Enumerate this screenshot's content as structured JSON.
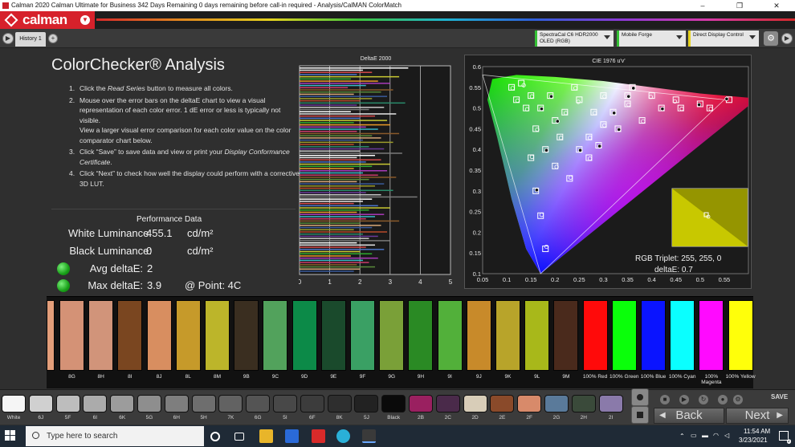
{
  "window": {
    "title": "Calman 2020 Calman Ultimate for Business 342 Days Remaining 0 days remaining before call-in required - Analysis/CalMAN ColorMatch",
    "controls": [
      "–",
      "❐",
      "✕"
    ]
  },
  "brand": {
    "name": "calman"
  },
  "tabs": {
    "history_label": "History 1",
    "add_label": "+",
    "devices": [
      {
        "line1": "SpectraCal C6 HDR2000",
        "line2": "OLED (RGB)",
        "accent": "#34c034"
      },
      {
        "line1": "Mobile Forge",
        "line2": "",
        "accent": "#34c034"
      },
      {
        "line1": "Direct Display Control",
        "line2": "",
        "accent": "#e6d21e"
      }
    ]
  },
  "analysis": {
    "title": "ColorChecker® Analysis",
    "instructions": [
      {
        "num": "1.",
        "parts": [
          {
            "t": "Click the "
          },
          {
            "t": "Read Series",
            "i": true
          },
          {
            "t": " button to measure all colors."
          }
        ]
      },
      {
        "num": "2.",
        "parts": [
          {
            "t": "Mouse over the error bars on the deltaE chart to view a visual representation of each color error. 1 dE error or less is typically not visible."
          }
        ],
        "extra": "View a larger visual error comparison for each color value on the color comparator chart below."
      },
      {
        "num": "3.",
        "parts": [
          {
            "t": "Click “Save” to save data and view or print your "
          },
          {
            "t": "Display Conformance Certificate",
            "i": true
          },
          {
            "t": "."
          }
        ]
      },
      {
        "num": "4.",
        "parts": [
          {
            "t": "Click “Next” to check how well the display could perform with a corrective 3D LUT."
          }
        ]
      }
    ]
  },
  "performance": {
    "title": "Performance Data",
    "white_label": "White Luminance:",
    "white_value": "455.1",
    "white_unit": "cd/m²",
    "black_label": "Black Luminance:",
    "black_value": "0",
    "black_unit": "cd/m²",
    "avg_label": "Avg deltaE:",
    "avg_value": "2",
    "max_label": "Max deltaE:",
    "max_value": "3.9",
    "point_text": "@ Point: 4C",
    "status_color": "#1fb01f"
  },
  "chart_data": [
    {
      "type": "bar",
      "title": "DeltaE 2000",
      "orientation": "horizontal",
      "xlim": [
        0,
        5
      ],
      "xticks": [
        0,
        1,
        2,
        3,
        4,
        5
      ],
      "grid": true,
      "values": [
        3.6,
        2.1,
        2.4,
        1.9,
        3.3,
        1.7,
        2.6,
        3.0,
        2.2,
        1.6,
        3.1,
        2.7,
        1.8,
        2.9,
        2.4,
        2.0,
        3.5,
        1.9,
        2.8,
        2.3,
        1.7,
        3.2,
        2.5,
        2.0,
        2.9,
        1.8,
        3.0,
        2.2,
        2.6,
        1.9,
        3.3,
        2.4,
        2.7,
        2.1,
        3.1,
        1.8,
        2.3,
        2.8,
        2.0,
        3.4,
        2.5,
        1.9,
        2.7,
        2.2,
        3.0,
        2.4,
        1.8,
        2.9,
        2.1,
        2.6,
        3.2,
        2.3,
        1.9,
        2.8,
        2.5,
        2.0,
        3.1,
        2.2,
        2.7,
        3.9,
        2.4,
        2.1,
        1.8,
        2.6,
        3.0,
        2.3,
        1.9,
        2.8,
        2.5,
        2.2,
        3.3,
        2.0,
        2.7,
        2.4,
        1.8,
        2.9,
        2.1,
        2.6,
        2.3,
        3.0,
        1.9,
        2.5,
        2.2,
        2.8,
        2.0,
        2.4,
        1.7,
        2.6,
        2.1,
        2.3,
        1.9,
        2.5,
        2.0,
        1.8
      ],
      "colors": [
        "#ffffff",
        "#e6e6e6",
        "#d44848",
        "#4a74c8",
        "#c8c832",
        "#2ea82e",
        "#ea9a28",
        "#a83ab8",
        "#38b8c8",
        "#c83a6a",
        "#8a5a2a",
        "#5a8a3a",
        "#d8a878",
        "#3a5a9a",
        "#9a9a2a",
        "#b84a2a",
        "#2a8a6a",
        "#6a3a9a",
        "#c8c8c8",
        "#7a7a7a"
      ]
    },
    {
      "type": "scatter",
      "title": "CIE 1976 u'v'",
      "xlim": [
        0.05,
        0.6
      ],
      "ylim": [
        0.1,
        0.6
      ],
      "xticks": [
        0.05,
        0.1,
        0.15,
        0.2,
        0.25,
        0.3,
        0.35,
        0.4,
        0.45,
        0.5,
        0.55
      ],
      "yticks": [
        0.1,
        0.15,
        0.2,
        0.25,
        0.3,
        0.35,
        0.4,
        0.45,
        0.5,
        0.55,
        0.6
      ],
      "gamut": {
        "red": [
          0.55,
          0.52
        ],
        "green": [
          0.05,
          0.58
        ],
        "blue": [
          0.17,
          0.1
        ]
      },
      "targets": [
        [
          0.56,
          0.52
        ],
        [
          0.13,
          0.56
        ],
        [
          0.18,
          0.16
        ],
        [
          0.2,
          0.47
        ],
        [
          0.25,
          0.52
        ],
        [
          0.3,
          0.53
        ],
        [
          0.35,
          0.53
        ],
        [
          0.4,
          0.53
        ],
        [
          0.45,
          0.52
        ],
        [
          0.5,
          0.51
        ],
        [
          0.14,
          0.5
        ],
        [
          0.16,
          0.45
        ],
        [
          0.18,
          0.4
        ],
        [
          0.2,
          0.36
        ],
        [
          0.23,
          0.33
        ],
        [
          0.25,
          0.4
        ],
        [
          0.27,
          0.43
        ],
        [
          0.3,
          0.46
        ],
        [
          0.32,
          0.49
        ],
        [
          0.35,
          0.51
        ],
        [
          0.15,
          0.38
        ],
        [
          0.16,
          0.3
        ],
        [
          0.17,
          0.24
        ],
        [
          0.38,
          0.47
        ],
        [
          0.42,
          0.5
        ],
        [
          0.28,
          0.49
        ],
        [
          0.22,
          0.49
        ],
        [
          0.19,
          0.53
        ],
        [
          0.15,
          0.53
        ],
        [
          0.24,
          0.55
        ],
        [
          0.36,
          0.55
        ],
        [
          0.46,
          0.5
        ],
        [
          0.52,
          0.5
        ],
        [
          0.33,
          0.45
        ],
        [
          0.27,
          0.38
        ],
        [
          0.21,
          0.43
        ],
        [
          0.29,
          0.41
        ],
        [
          0.12,
          0.52
        ],
        [
          0.11,
          0.55
        ],
        [
          0.17,
          0.5
        ]
      ],
      "measured": [
        [
          0.555,
          0.522
        ],
        [
          0.135,
          0.555
        ],
        [
          0.182,
          0.165
        ],
        [
          0.205,
          0.468
        ],
        [
          0.248,
          0.515
        ],
        [
          0.302,
          0.528
        ],
        [
          0.352,
          0.528
        ],
        [
          0.398,
          0.527
        ],
        [
          0.448,
          0.516
        ],
        [
          0.498,
          0.508
        ],
        [
          0.142,
          0.497
        ],
        [
          0.163,
          0.448
        ],
        [
          0.182,
          0.398
        ],
        [
          0.203,
          0.358
        ],
        [
          0.232,
          0.332
        ],
        [
          0.252,
          0.398
        ],
        [
          0.272,
          0.428
        ],
        [
          0.302,
          0.458
        ],
        [
          0.322,
          0.488
        ],
        [
          0.352,
          0.508
        ],
        [
          0.152,
          0.382
        ],
        [
          0.162,
          0.302
        ],
        [
          0.172,
          0.242
        ],
        [
          0.382,
          0.468
        ],
        [
          0.422,
          0.498
        ],
        [
          0.282,
          0.488
        ],
        [
          0.222,
          0.488
        ],
        [
          0.192,
          0.528
        ],
        [
          0.152,
          0.528
        ],
        [
          0.242,
          0.548
        ],
        [
          0.362,
          0.548
        ],
        [
          0.462,
          0.498
        ],
        [
          0.522,
          0.498
        ],
        [
          0.332,
          0.448
        ],
        [
          0.272,
          0.378
        ],
        [
          0.212,
          0.428
        ],
        [
          0.292,
          0.408
        ],
        [
          0.122,
          0.518
        ],
        [
          0.112,
          0.548
        ],
        [
          0.172,
          0.498
        ]
      ]
    }
  ],
  "triplet": {
    "rgb": "RGB Triplet: 255, 255, 0",
    "delta": "deltaE: 0.7",
    "target_color": "#d4d400",
    "measured_color": "#c8c800"
  },
  "swatches": [
    {
      "label": "",
      "color": "#e39e7a"
    },
    {
      "label": "8G",
      "color": "#d49276"
    },
    {
      "label": "8H",
      "color": "#d1947a"
    },
    {
      "label": "8I",
      "color": "#7a4620"
    },
    {
      "label": "8J",
      "color": "#d88e60"
    },
    {
      "label": "8L",
      "color": "#c69a2a"
    },
    {
      "label": "8M",
      "color": "#bcb52a"
    },
    {
      "label": "9B",
      "color": "#3a2e20"
    },
    {
      "label": "9C",
      "color": "#52a25c"
    },
    {
      "label": "9D",
      "color": "#0c8a48"
    },
    {
      "label": "9E",
      "color": "#1a4a2c"
    },
    {
      "label": "9F",
      "color": "#3aa064"
    },
    {
      "label": "9G",
      "color": "#7aa038"
    },
    {
      "label": "9H",
      "color": "#2a8a24"
    },
    {
      "label": "9I",
      "color": "#52b03a"
    },
    {
      "label": "9J",
      "color": "#c88a2a"
    },
    {
      "label": "9K",
      "color": "#b8a42a"
    },
    {
      "label": "9L",
      "color": "#a8b81a"
    },
    {
      "label": "9M",
      "color": "#4a2a1c"
    },
    {
      "label": "100% Red",
      "color": "#ff0a0a"
    },
    {
      "label": "100% Green",
      "color": "#0aff0a"
    },
    {
      "label": "100% Blue",
      "color": "#0a14ff"
    },
    {
      "label": "100% Cyan",
      "color": "#0affff"
    },
    {
      "label": "100% Magenta",
      "color": "#ff0aff"
    },
    {
      "label": "100% Yellow",
      "color": "#ffff0a"
    }
  ],
  "grayscale": [
    {
      "label": "White",
      "color": "#f5f5f5"
    },
    {
      "label": "6J",
      "color": "#d0d0d0"
    },
    {
      "label": "5F",
      "color": "#bdbdbd"
    },
    {
      "label": "6I",
      "color": "#ababab"
    },
    {
      "label": "6K",
      "color": "#9c9c9c"
    },
    {
      "label": "5G",
      "color": "#8e8e8e"
    },
    {
      "label": "6H",
      "color": "#7e7e7e"
    },
    {
      "label": "5H",
      "color": "#6e6e6e"
    },
    {
      "label": "7K",
      "color": "#626262"
    },
    {
      "label": "6G",
      "color": "#545454"
    },
    {
      "label": "5I",
      "color": "#484848"
    },
    {
      "label": "6F",
      "color": "#3c3c3c"
    },
    {
      "label": "8K",
      "color": "#2e2e2e"
    },
    {
      "label": "5J",
      "color": "#222222"
    },
    {
      "label": "Black",
      "color": "#0a0a0a"
    },
    {
      "label": "2B",
      "color": "#9a2060"
    },
    {
      "label": "2C",
      "color": "#4a2a4a"
    },
    {
      "label": "2D",
      "color": "#d8cdb8"
    },
    {
      "label": "2E",
      "color": "#8a4a2a"
    },
    {
      "label": "2F",
      "color": "#d88a6a"
    },
    {
      "label": "2G",
      "color": "#5a7a9a"
    },
    {
      "label": "2H",
      "color": "#3a4a3a"
    },
    {
      "label": "2I",
      "color": "#8a7aaa"
    }
  ],
  "nav": {
    "back_label": "Back",
    "next_label": "Next",
    "save_label": "SAVE"
  },
  "taskbar": {
    "search_placeholder": "Type here to search",
    "time": "11:54 AM",
    "date": "3/23/2021",
    "notifications": "2"
  }
}
